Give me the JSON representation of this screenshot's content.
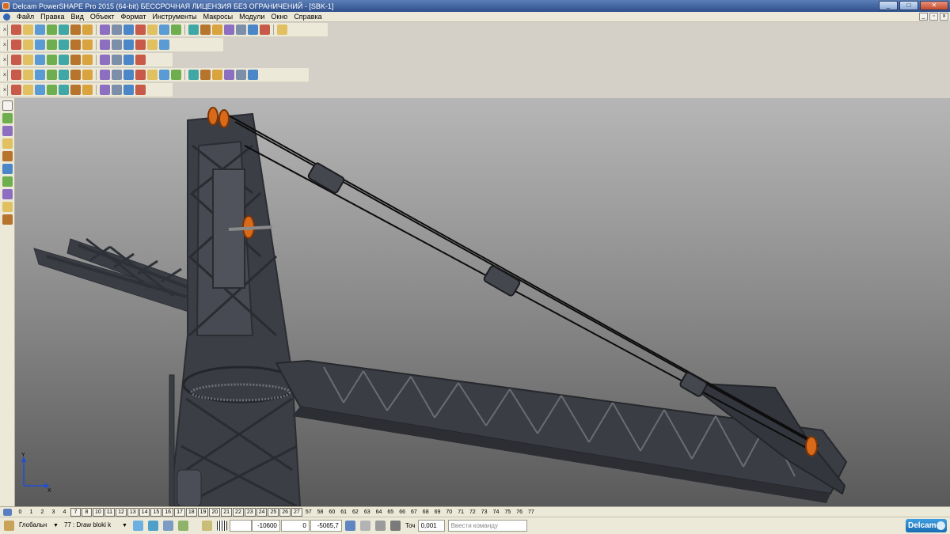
{
  "window": {
    "title": "Delcam PowerSHAPE Pro 2015 (64-bit) БЕССРОЧНАЯ ЛИЦЕНЗИЯ БЕЗ ОГРАНИЧЕНИЙ - [SBK-1]",
    "minimize": "_",
    "maximize": "□",
    "close": "✕"
  },
  "menu": {
    "items": [
      "Файл",
      "Правка",
      "Вид",
      "Объект",
      "Формат",
      "Инструменты",
      "Макросы",
      "Модули",
      "Окно",
      "Справка"
    ]
  },
  "layers": {
    "items": [
      {
        "label": "0",
        "boxed": false
      },
      {
        "label": "1",
        "boxed": false
      },
      {
        "label": "2",
        "boxed": false
      },
      {
        "label": "3",
        "boxed": false
      },
      {
        "label": "4",
        "boxed": false
      },
      {
        "label": "7",
        "boxed": true
      },
      {
        "label": "8",
        "boxed": true
      },
      {
        "label": "10",
        "boxed": true
      },
      {
        "label": "11",
        "boxed": true
      },
      {
        "label": "12",
        "boxed": true
      },
      {
        "label": "13",
        "boxed": true
      },
      {
        "label": "14",
        "boxed": true
      },
      {
        "label": "15",
        "boxed": true
      },
      {
        "label": "16",
        "boxed": true
      },
      {
        "label": "17",
        "boxed": true
      },
      {
        "label": "18",
        "boxed": true
      },
      {
        "label": "19",
        "boxed": true
      },
      {
        "label": "20",
        "boxed": true
      },
      {
        "label": "21",
        "boxed": true
      },
      {
        "label": "22",
        "boxed": true
      },
      {
        "label": "23",
        "boxed": true
      },
      {
        "label": "24",
        "boxed": true
      },
      {
        "label": "25",
        "boxed": true
      },
      {
        "label": "26",
        "boxed": true
      },
      {
        "label": "27",
        "boxed": true
      },
      {
        "label": "57",
        "boxed": false
      },
      {
        "label": "58",
        "boxed": false
      },
      {
        "label": "60",
        "boxed": false
      },
      {
        "label": "61",
        "boxed": false
      },
      {
        "label": "62",
        "boxed": false
      },
      {
        "label": "63",
        "boxed": false
      },
      {
        "label": "64",
        "boxed": false
      },
      {
        "label": "65",
        "boxed": false
      },
      {
        "label": "66",
        "boxed": false
      },
      {
        "label": "67",
        "boxed": false
      },
      {
        "label": "68",
        "boxed": false
      },
      {
        "label": "69",
        "boxed": false
      },
      {
        "label": "70",
        "boxed": false
      },
      {
        "label": "71",
        "boxed": false
      },
      {
        "label": "72",
        "boxed": false
      },
      {
        "label": "73",
        "boxed": false
      },
      {
        "label": "74",
        "boxed": false
      },
      {
        "label": "75",
        "boxed": false
      },
      {
        "label": "76",
        "boxed": false
      },
      {
        "label": "77",
        "boxed": false
      }
    ]
  },
  "status": {
    "workplane": "Глобальн",
    "layer": "77 : Draw bloki k",
    "x": "-10600",
    "y": "0",
    "z": "-5065,7",
    "tolerance_label": "Точ",
    "tolerance": "0,001",
    "command_placeholder": "Ввести команду",
    "brand": "Delcam"
  },
  "axis": {
    "y": "Y",
    "x": "X"
  },
  "colors": {
    "accent": "#d96a1a",
    "steel": "#3a3c44"
  }
}
